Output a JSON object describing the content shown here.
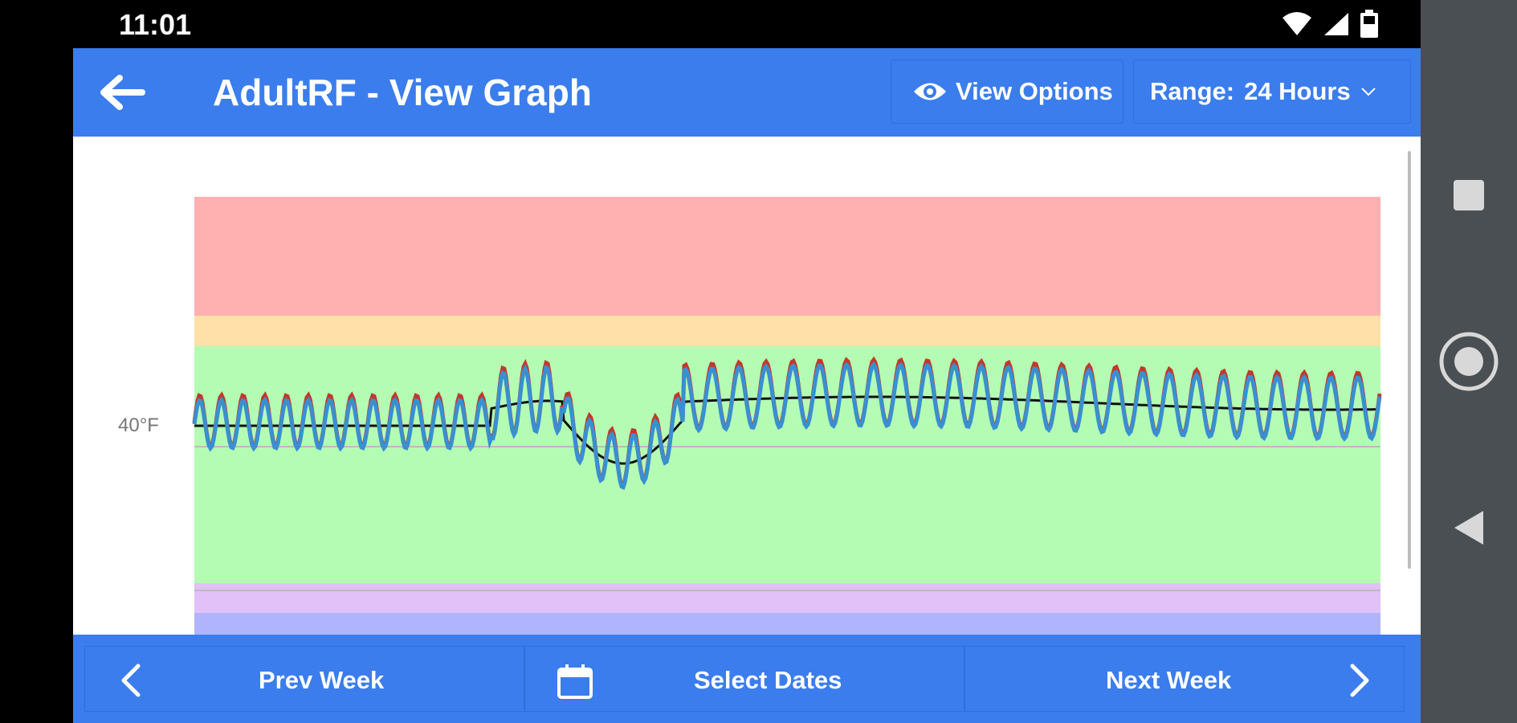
{
  "status_bar": {
    "time": "11:01",
    "icons": [
      "wifi-icon",
      "cell-signal-icon",
      "battery-icon"
    ]
  },
  "toolbar": {
    "back_icon": "arrow-left-icon",
    "title": "AdultRF - View Graph",
    "view_options_icon": "eye-icon",
    "view_options_label": "View Options",
    "range_label": "Range:",
    "range_value": "24 Hours",
    "range_icon": "chevron-down-icon"
  },
  "chart": {
    "y_tick_label": "40°F",
    "bands": [
      {
        "name": "alarm-high",
        "color": "#ffb0b0"
      },
      {
        "name": "warning-high",
        "color": "#ffe0a8"
      },
      {
        "name": "normal",
        "color": "#b4fcb4"
      },
      {
        "name": "warning-low",
        "color": "#e2c0f8"
      },
      {
        "name": "alarm-low",
        "color": "#b0b4fc"
      }
    ],
    "series_colors": {
      "probe": "#3a8fd0",
      "peaks": "#c0392b",
      "average": "#111111"
    }
  },
  "bottom_bar": {
    "prev_week_label": "Prev Week",
    "prev_week_icon": "chevron-left-icon",
    "select_dates_label": "Select Dates",
    "select_dates_icon": "calendar-icon",
    "next_week_label": "Next Week",
    "next_week_icon": "chevron-right-icon"
  },
  "nav_bar": {
    "buttons": [
      "recent-apps-icon",
      "home-icon",
      "back-nav-icon"
    ]
  }
}
